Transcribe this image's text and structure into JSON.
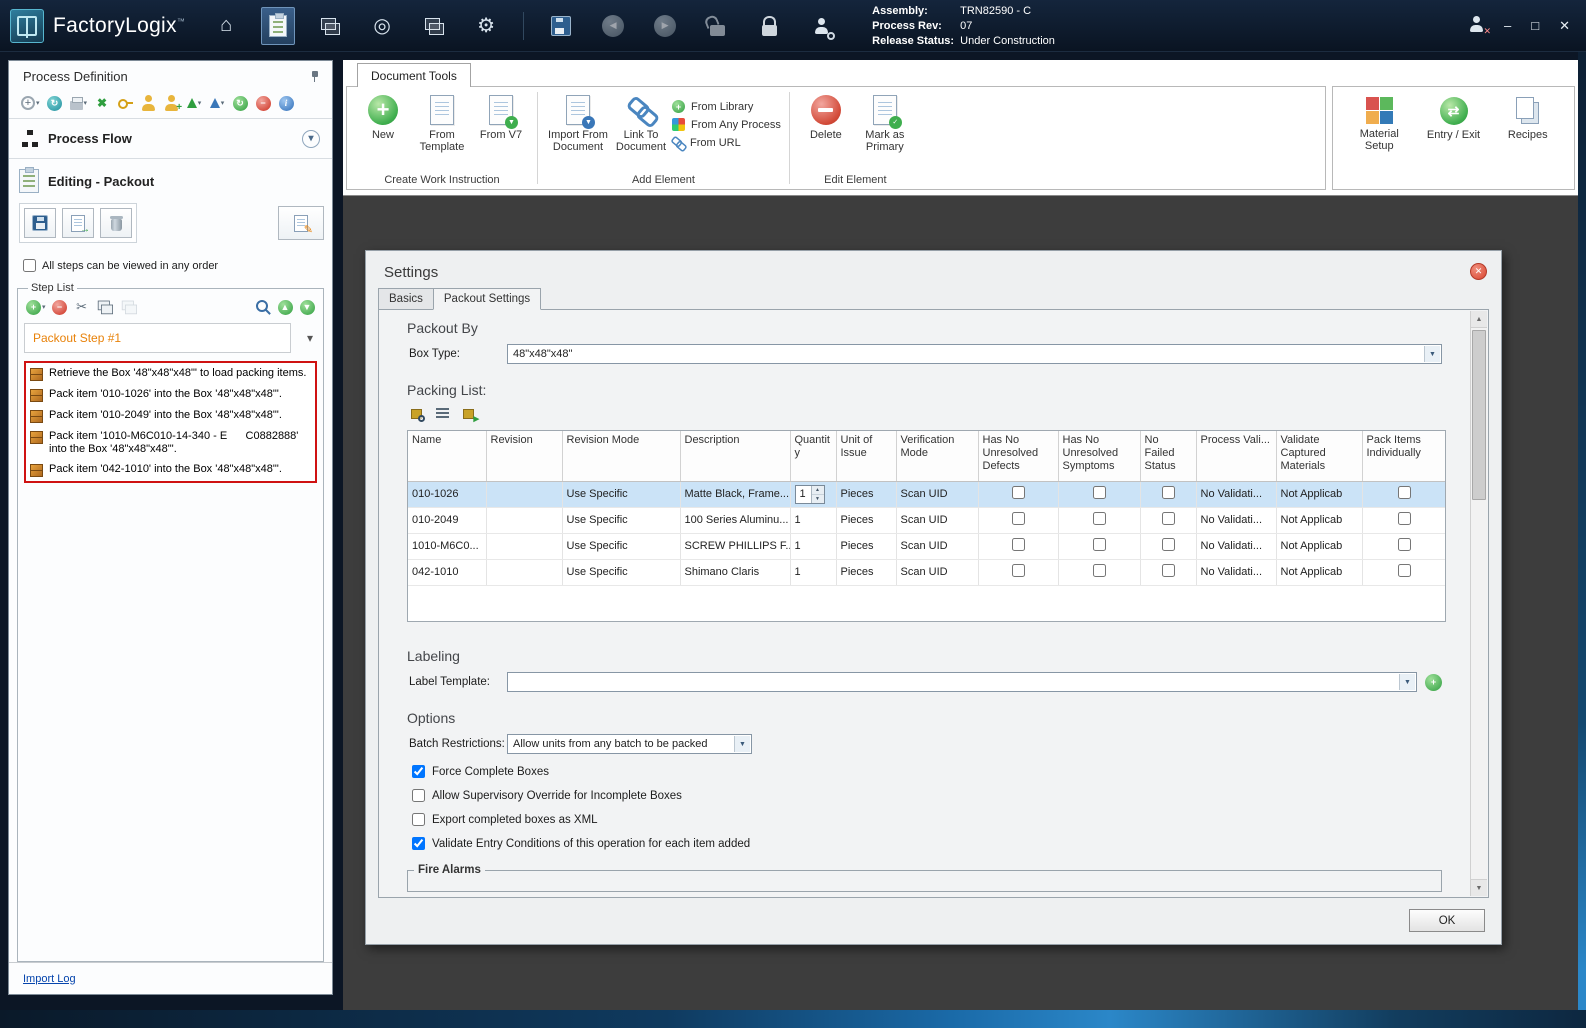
{
  "titlebar": {
    "app_name": "FactoryLogix",
    "trademark": "™",
    "info": [
      {
        "label": "Assembly:",
        "value": "TRN82590 - C"
      },
      {
        "label": "Process Rev:",
        "value": "07"
      },
      {
        "label": "Release Status:",
        "value": "Under Construction"
      }
    ]
  },
  "sidebar": {
    "title": "Process Definition",
    "process_flow": "Process Flow",
    "editing": "Editing - Packout",
    "order_checkbox": {
      "label": "All steps can be viewed in any order",
      "checked": false
    },
    "step_list": {
      "title": "Step List",
      "selected_step": "Packout Step #1",
      "steps": [
        {
          "text": "Retrieve the Box '48\"x48\"x48\"' to load packing items."
        },
        {
          "text": "Pack item '010-1026' into the Box '48\"x48\"x48\"'."
        },
        {
          "text": "Pack item '010-2049' into the Box '48\"x48\"x48\"'."
        },
        {
          "text": "Pack item '1010-M6C010-14-340 - E      C0882888' into the Box '48\"x48\"x48\"'."
        },
        {
          "text": "Pack item '042-1010' into the Box '48\"x48\"x48\"'."
        }
      ]
    },
    "import_log": "Import Log"
  },
  "ribbon": {
    "tab": "Document Tools",
    "create_group": {
      "label": "Create Work Instruction",
      "new": "New",
      "from_template": "From Template",
      "from_v7": "From V7"
    },
    "add_group": {
      "label": "Add Element",
      "import_from_document": "Import From Document",
      "link_to_document": "Link To Document",
      "from_library": "From Library",
      "from_any_process": "From Any Process",
      "from_url": "From URL"
    },
    "edit_group": {
      "label": "Edit Element",
      "delete": "Delete",
      "mark_as_primary": "Mark as Primary"
    },
    "tools": {
      "material_setup": "Material Setup",
      "entry_exit": "Entry / Exit",
      "recipes": "Recipes"
    }
  },
  "dialog": {
    "title": "Settings",
    "tabs": {
      "basics": "Basics",
      "packout": "Packout Settings"
    },
    "packout_by": {
      "heading": "Packout By",
      "box_type_label": "Box Type:",
      "box_type_value": "48\"x48\"x48\""
    },
    "packing_list": {
      "heading": "Packing List:",
      "columns": [
        "Name",
        "Revision",
        "Revision Mode",
        "Description",
        "Quantity",
        "Unit of Issue",
        "Verification Mode",
        "Has No Unresolved Defects",
        "Has No Unresolved Symptoms",
        "No Failed Status",
        "Process Vali...",
        "Validate Captured Materials",
        "Pack Items Individually"
      ],
      "rows": [
        {
          "name": "010-1026",
          "revision": "",
          "revision_mode": "Use Specific",
          "description": "Matte Black, Frame...",
          "quantity": "1",
          "unit": "Pieces",
          "verification": "Scan UID",
          "no_defects": false,
          "no_symptoms": false,
          "no_failed": false,
          "process_validation": "No Validati...",
          "validate_captured": "Not Applicab",
          "pack_individually": false
        },
        {
          "name": "010-2049",
          "revision": "",
          "revision_mode": "Use Specific",
          "description": "100 Series Aluminu...",
          "quantity": "1",
          "unit": "Pieces",
          "verification": "Scan UID",
          "no_defects": false,
          "no_symptoms": false,
          "no_failed": false,
          "process_validation": "No Validati...",
          "validate_captured": "Not Applicab",
          "pack_individually": false
        },
        {
          "name": "1010-M6C0...",
          "revision": "",
          "revision_mode": "Use Specific",
          "description": "SCREW PHILLIPS F...",
          "quantity": "1",
          "unit": "Pieces",
          "verification": "Scan UID",
          "no_defects": false,
          "no_symptoms": false,
          "no_failed": false,
          "process_validation": "No Validati...",
          "validate_captured": "Not Applicab",
          "pack_individually": false
        },
        {
          "name": "042-1010",
          "revision": "",
          "revision_mode": "Use Specific",
          "description": "Shimano Claris",
          "quantity": "1",
          "unit": "Pieces",
          "verification": "Scan UID",
          "no_defects": false,
          "no_symptoms": false,
          "no_failed": false,
          "process_validation": "No Validati...",
          "validate_captured": "Not Applicab",
          "pack_individually": false
        }
      ]
    },
    "labeling": {
      "heading": "Labeling",
      "label_template_label": "Label Template:",
      "label_template_value": ""
    },
    "options": {
      "heading": "Options",
      "batch_label": "Batch Restrictions:",
      "batch_value": "Allow units from any batch to be packed",
      "checkboxes": [
        {
          "label": "Force Complete Boxes",
          "checked": true
        },
        {
          "label": "Allow Supervisory Override for Incomplete Boxes",
          "checked": false
        },
        {
          "label": "Export completed boxes as XML",
          "checked": false
        },
        {
          "label": "Validate Entry Conditions of this operation for each item added",
          "checked": true
        }
      ]
    },
    "fire_alarms": "Fire Alarms",
    "ok": "OK"
  }
}
